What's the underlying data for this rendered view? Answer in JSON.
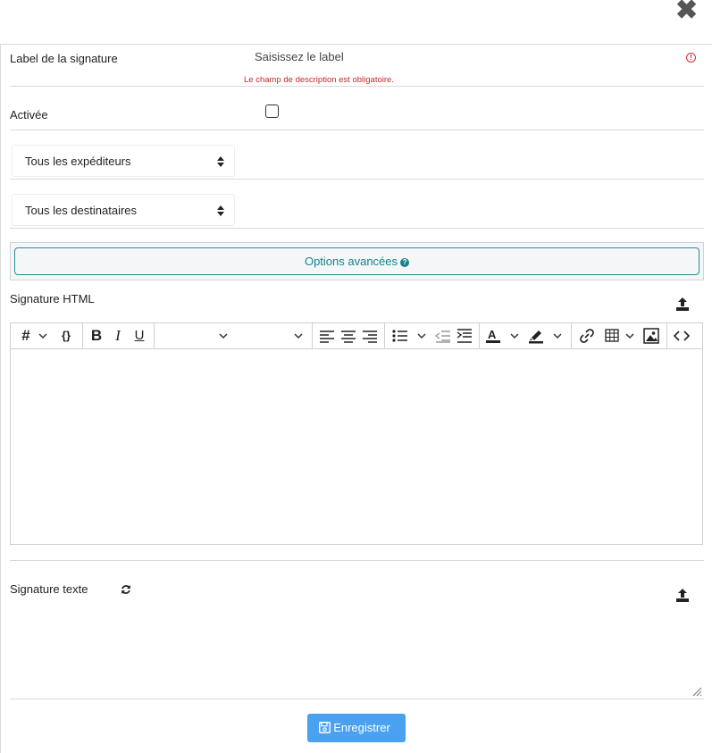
{
  "dialog": {
    "close_label": "✖"
  },
  "form": {
    "label_field": {
      "label": "Label de la signature",
      "placeholder": "Saisissez le label",
      "error": "Le champ de description est obligatoire.",
      "error_icon": "!"
    },
    "active_field": {
      "label": "Activée"
    },
    "senders_select": {
      "value": "Tous les expéditeurs"
    },
    "recipients_select": {
      "value": "Tous les destinataires"
    },
    "advanced": {
      "label": "Options avancées",
      "help_icon": "?"
    },
    "html_signature": {
      "label": "Signature HTML"
    },
    "text_signature": {
      "label": "Signature texte"
    },
    "save_label": "Enregistrer"
  },
  "toolbar": {
    "heading": "#",
    "variables": "{}",
    "bold": "B",
    "italic": "I",
    "underline": "U",
    "font_family_value": "",
    "font_size_value": ""
  },
  "colors": {
    "accent": "#15838c",
    "primary_button": "#4aa1f0",
    "error": "#c62828"
  }
}
